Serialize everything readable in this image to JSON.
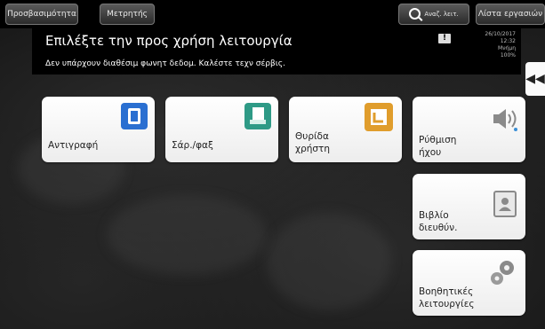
{
  "topbar": {
    "preferences_label": "Προσβασιμότητα",
    "counter_label": "Μετρητής",
    "search_label": "Αναζ. λειτ.",
    "job_list_label": "Λίστα εργασιών"
  },
  "header": {
    "title": "Επιλέξτε την προς χρήση λειτουργία",
    "message": "Δεν υπάρχουν διαθέσιμ φωνητ δεδομ. Καλέστε τεχν σέρβις.",
    "notice_icon": "!",
    "date": "26/10/2017",
    "time": "12:32",
    "memory_label": "Μνήμη",
    "memory_value": "100%"
  },
  "side_tab": {
    "icon": "rewind-icon",
    "glyph": "◀◀"
  },
  "tiles": {
    "copy": {
      "label": "Αντιγραφή",
      "icon": "copy-icon",
      "color": "#2a6fd1"
    },
    "scan_fax": {
      "label": "Σάρ./φαξ",
      "icon": "scan-fax-icon",
      "color": "#2e9a86"
    },
    "user_box": {
      "label_1": "Θυρίδα",
      "label_2": "χρήστη",
      "icon": "user-box-icon",
      "color": "#e09d2c"
    },
    "sound": {
      "label_1": "Ρύθμιση",
      "label_2": "ήχου",
      "icon": "speaker-icon",
      "color": "#8a8a8a"
    },
    "address_book": {
      "label_1": "Βιβλίο",
      "label_2": "διευθύν.",
      "icon": "address-book-icon",
      "color": "#8a8a8a"
    },
    "utility": {
      "label_1": "Βοηθητικές",
      "label_2": "λειτουργίες",
      "icon": "gears-icon",
      "color": "#8a8a8a"
    }
  }
}
